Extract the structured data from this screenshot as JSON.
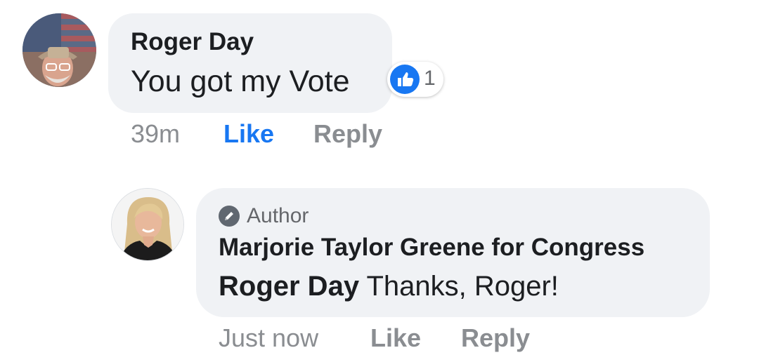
{
  "comments": [
    {
      "author": "Roger Day",
      "text": "You got my Vote",
      "reaction": {
        "icon": "thumbs-up-icon",
        "count": "1",
        "color": "#1877f2"
      },
      "actions": {
        "time": "39m",
        "like": "Like",
        "reply": "Reply"
      }
    }
  ],
  "reply": {
    "badge_icon": "pencil-icon",
    "badge": "Author",
    "author": "Marjorie Taylor Greene for Congress",
    "mention": "Roger Day",
    "text": " Thanks, Roger!",
    "actions": {
      "time": "Just now",
      "like": "Like",
      "reply": "Reply"
    }
  },
  "colors": {
    "bubble": "#f0f2f5",
    "like_active": "#1877f2",
    "meta": "#8a8d91"
  }
}
